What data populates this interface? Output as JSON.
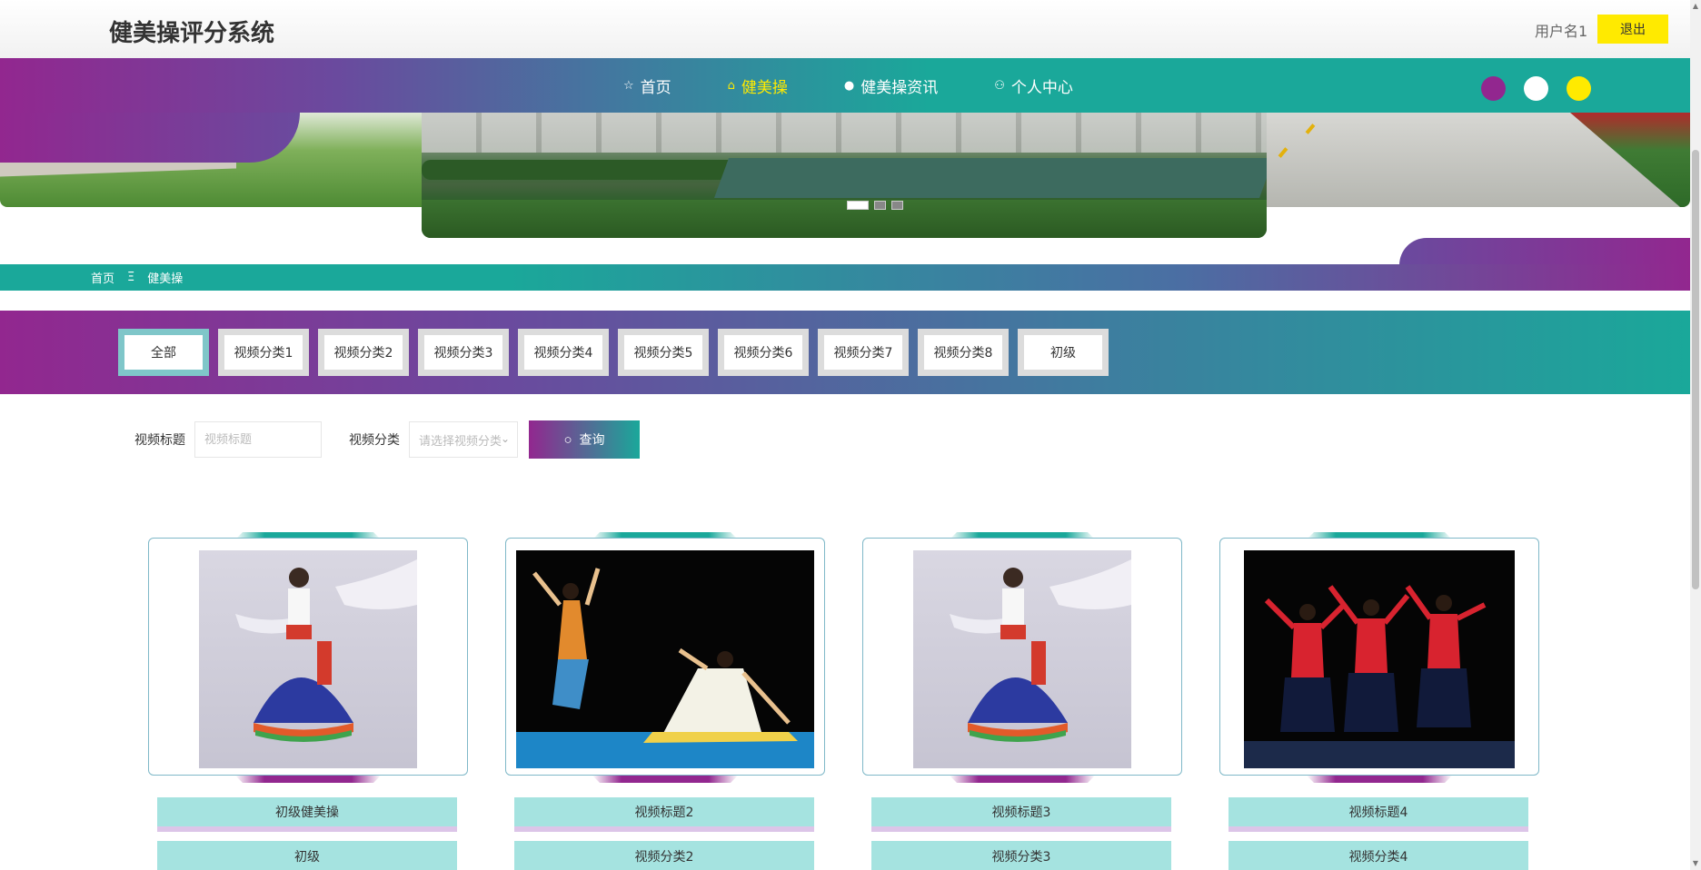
{
  "header": {
    "site_title": "健美操评分系统",
    "username": "用户名1",
    "logout_label": "退出"
  },
  "nav": {
    "items": [
      {
        "label": "首页",
        "icon": "star-icon"
      },
      {
        "label": "健美操",
        "icon": "bag-icon",
        "active": true
      },
      {
        "label": "健美操资讯",
        "icon": "info-icon"
      },
      {
        "label": "个人中心",
        "icon": "user-icon"
      }
    ],
    "theme_colors": [
      "#92278f",
      "#ffffff",
      "#ffea00"
    ]
  },
  "breadcrumb": {
    "home": "首页",
    "separator": "Ξ",
    "current": "健美操"
  },
  "categories": [
    "全部",
    "视频分类1",
    "视频分类2",
    "视频分类3",
    "视频分类4",
    "视频分类5",
    "视频分类6",
    "视频分类7",
    "视频分类8",
    "初级"
  ],
  "search": {
    "title_label": "视频标题",
    "title_placeholder": "视频标题",
    "category_label": "视频分类",
    "category_placeholder": "请选择视频分类",
    "button_label": "查询"
  },
  "cards": [
    {
      "title": "初级健美操",
      "category": "初级"
    },
    {
      "title": "视频标题2",
      "category": "视频分类2"
    },
    {
      "title": "视频标题3",
      "category": "视频分类3"
    },
    {
      "title": "视频标题4",
      "category": "视频分类4"
    }
  ],
  "colors": {
    "purple": "#92278f",
    "teal": "#1aa89a",
    "yellow": "#ffea00",
    "card_mint": "#a5e3e0"
  }
}
